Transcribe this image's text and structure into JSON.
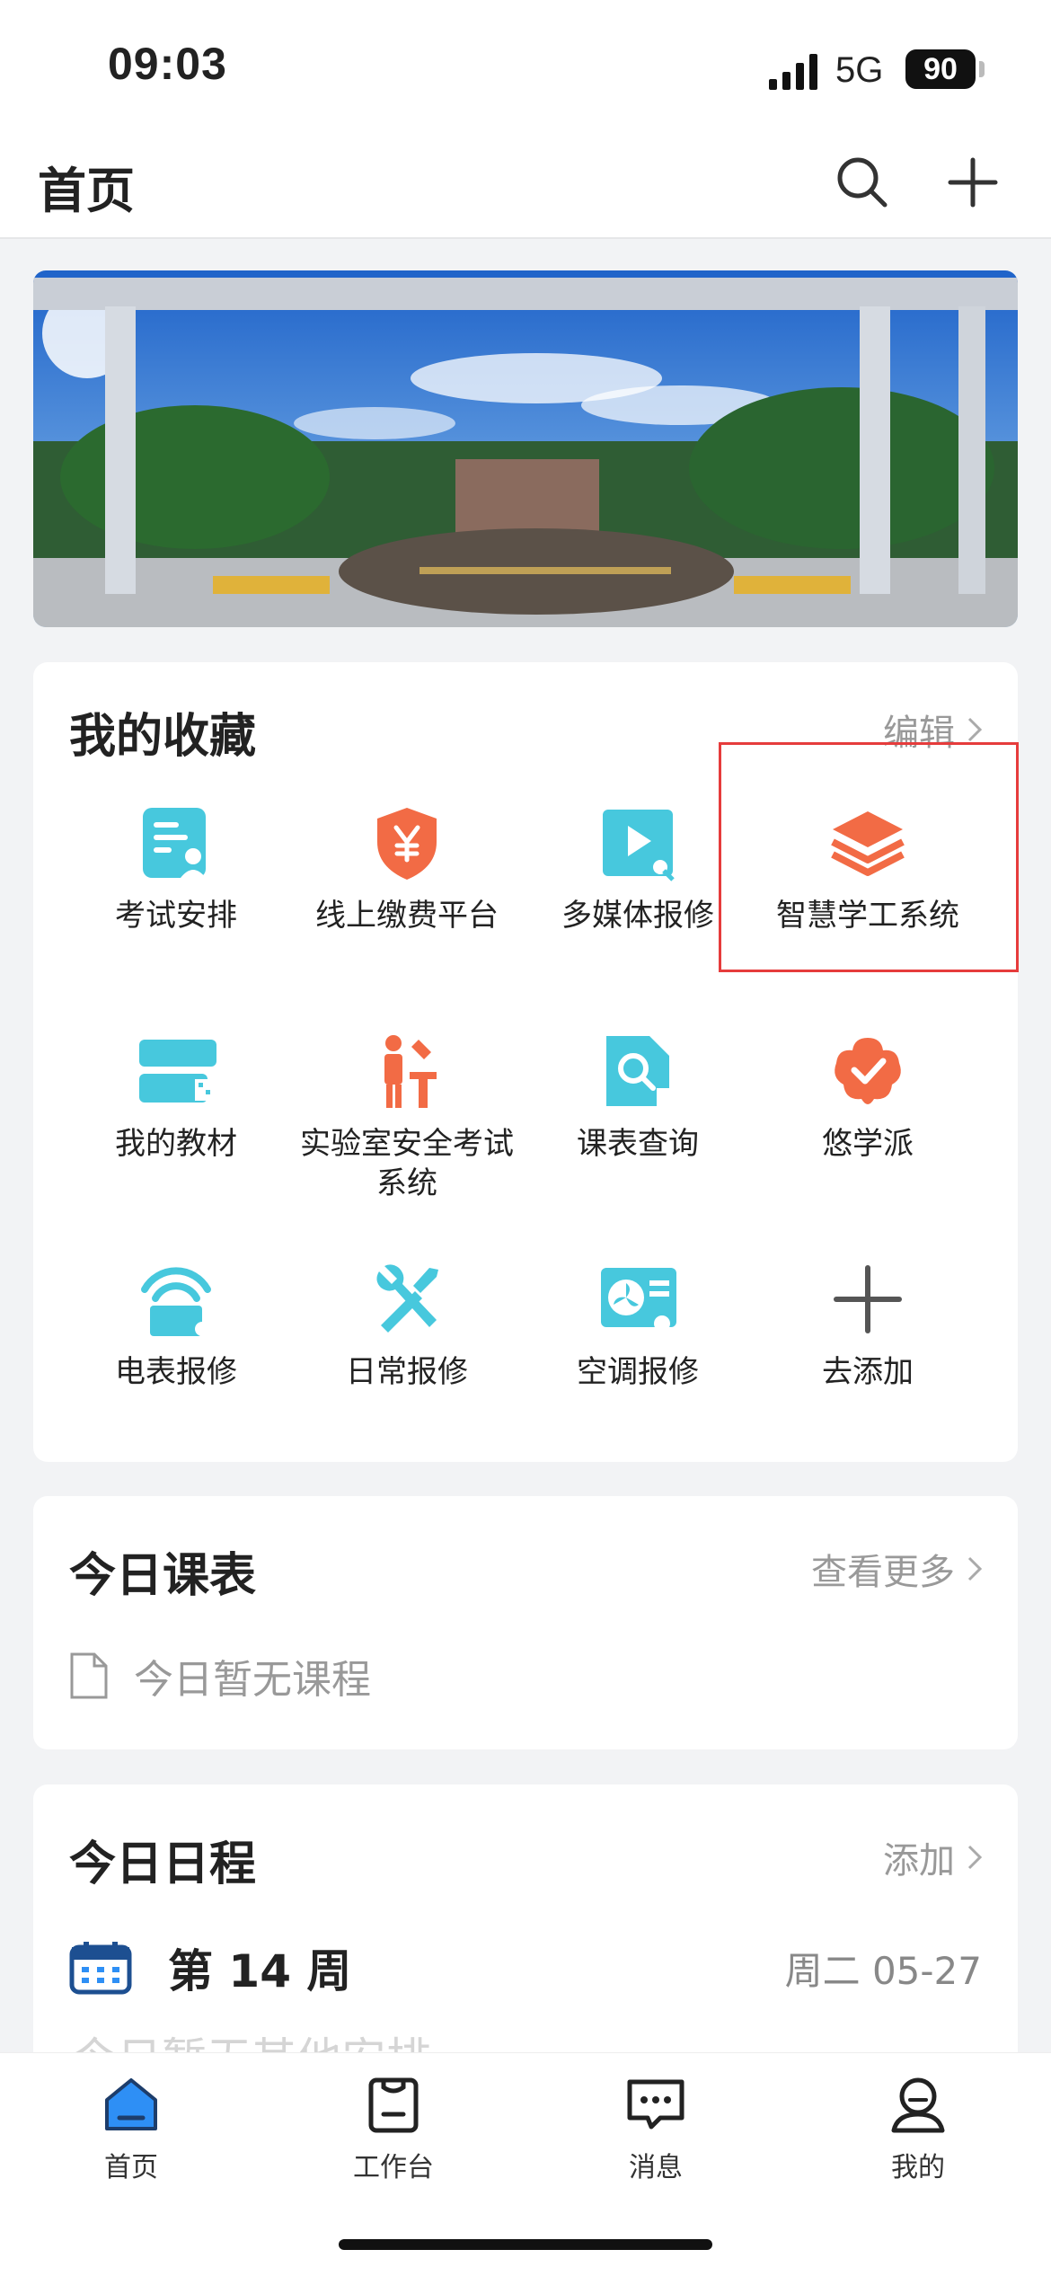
{
  "status_bar": {
    "time": "09:03",
    "network": "5G",
    "battery": "90"
  },
  "header": {
    "title": "首页"
  },
  "favorites": {
    "title": "我的收藏",
    "edit_label": "编辑",
    "items": [
      {
        "label": "考试安排",
        "icon": "exam-schedule-icon"
      },
      {
        "label": "线上缴费平台",
        "icon": "payment-shield-icon"
      },
      {
        "label": "多媒体报修",
        "icon": "multimedia-repair-icon"
      },
      {
        "label": "智慧学工系统",
        "icon": "layers-icon"
      },
      {
        "label": "我的教材",
        "icon": "textbook-icon"
      },
      {
        "label": "实验室安全考试系统",
        "icon": "lab-safety-icon"
      },
      {
        "label": "课表查询",
        "icon": "schedule-search-icon"
      },
      {
        "label": "悠学派",
        "icon": "youxuepai-icon"
      },
      {
        "label": "电表报修",
        "icon": "meter-repair-icon"
      },
      {
        "label": "日常报修",
        "icon": "tools-icon"
      },
      {
        "label": "空调报修",
        "icon": "ac-repair-icon"
      },
      {
        "label": "去添加",
        "icon": "plus-icon"
      }
    ]
  },
  "today_classes": {
    "title": "今日课表",
    "more_label": "查看更多",
    "empty_text": "今日暂无课程"
  },
  "today_schedule": {
    "title": "今日日程",
    "add_label": "添加",
    "week": "第 14 周",
    "date": "周二 05-27",
    "faded_text": "今日暂无其他安排"
  },
  "tabbar": {
    "items": [
      {
        "label": "首页"
      },
      {
        "label": "工作台"
      },
      {
        "label": "消息"
      },
      {
        "label": "我的"
      }
    ]
  },
  "colors": {
    "accent_blue": "#2e8ff5",
    "icon_teal": "#47c8dd",
    "icon_orange": "#f26b45",
    "highlight_red": "#e63c3c"
  }
}
